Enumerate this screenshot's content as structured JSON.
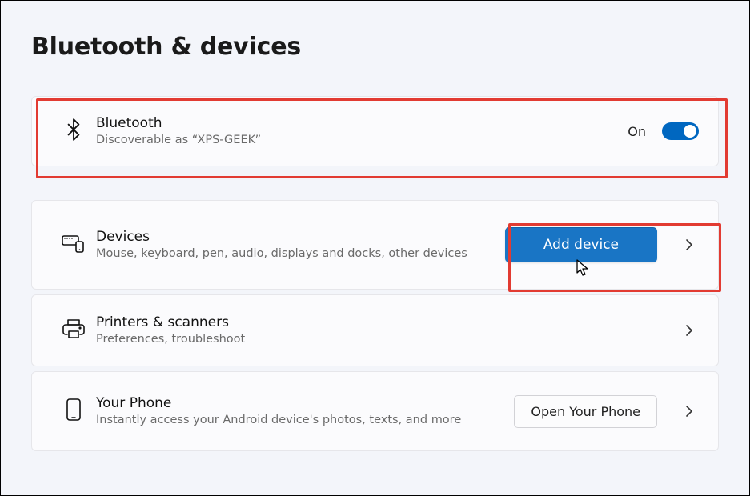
{
  "title": "Bluetooth & devices",
  "bluetooth": {
    "title": "Bluetooth",
    "subtitle": "Discoverable as “XPS-GEEK”",
    "state_label": "On"
  },
  "devices": {
    "title": "Devices",
    "subtitle": "Mouse, keyboard, pen, audio, displays and docks, other devices",
    "add_button": "Add device"
  },
  "printers": {
    "title": "Printers & scanners",
    "subtitle": "Preferences, troubleshoot"
  },
  "phone": {
    "title": "Your Phone",
    "subtitle": "Instantly access your Android device's photos, texts, and more",
    "open_button": "Open Your Phone"
  }
}
